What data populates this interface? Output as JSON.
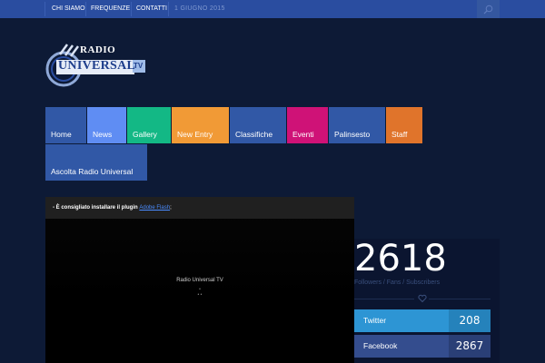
{
  "topbar": {
    "links": [
      "CHI SIAMO",
      "FREQUENZE",
      "CONTATTI"
    ],
    "date": "1 GIUGNO 2015"
  },
  "logo": {
    "line1": "RADIO",
    "line2": "UNIVERSAL",
    "badge": "TV"
  },
  "nav": {
    "items": [
      {
        "label": "Home",
        "color": "#3158a6"
      },
      {
        "label": "News",
        "color": "#5f8df3"
      },
      {
        "label": "Gallery",
        "color": "#13b885"
      },
      {
        "label": "New Entry",
        "color": "#f19a36"
      },
      {
        "label": "Classifiche",
        "color": "#3158a6"
      },
      {
        "label": "Eventi",
        "color": "#cf1277"
      },
      {
        "label": "Palinsesto",
        "color": "#3158a6"
      },
      {
        "label": "Staff",
        "color": "#e0742b"
      },
      {
        "label": "Ascolta Radio Universal",
        "color": "#3158a6"
      }
    ]
  },
  "video": {
    "notice_prefix": "- È consigliato installare il plugin ",
    "notice_link": "Adobe Flash",
    "notice_suffix": ";",
    "title": "Radio Universal TV",
    "dots": [
      "•",
      "• •"
    ]
  },
  "social": {
    "total": "2618",
    "caption": "Followers / Fans / Subscribers",
    "networks": [
      {
        "name": "Twitter",
        "count": "208",
        "color": "#2d95d4",
        "count_bg": "#2582bb"
      },
      {
        "name": "Facebook",
        "count": "2867",
        "color": "#344d8e",
        "count_bg": "#2a3f76"
      }
    ]
  },
  "colors": {
    "background": "#0d1a36",
    "topbar": "#2a4da0"
  }
}
